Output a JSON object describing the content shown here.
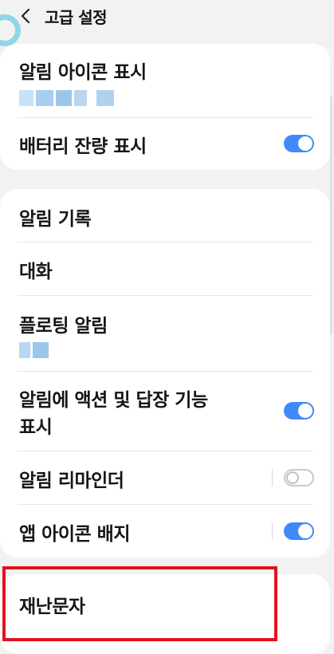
{
  "header": {
    "title": "고급 설정",
    "back_icon": "chevron-left-icon"
  },
  "sections": {
    "s1": {
      "notification_icons": {
        "label": "알림 아이콘 표시"
      },
      "battery": {
        "label": "배터리 잔량 표시",
        "enabled": true
      }
    },
    "s2": {
      "history": {
        "label": "알림 기록"
      },
      "conversations": {
        "label": "대화"
      },
      "floating": {
        "label": "플로팅 알림"
      },
      "actions": {
        "label_line1": "알림에 액션 및 답장 기능",
        "label_line2": "표시",
        "enabled": true
      },
      "reminder": {
        "label": "알림 리마인더",
        "enabled": false
      },
      "badge": {
        "label": "앱 아이콘 배지",
        "enabled": true
      }
    },
    "s3": {
      "emergency": {
        "label": "재난문자"
      }
    }
  },
  "colors": {
    "accent": "#3f8af7",
    "highlight": "#e0141e",
    "background": "#f2f2f2"
  }
}
